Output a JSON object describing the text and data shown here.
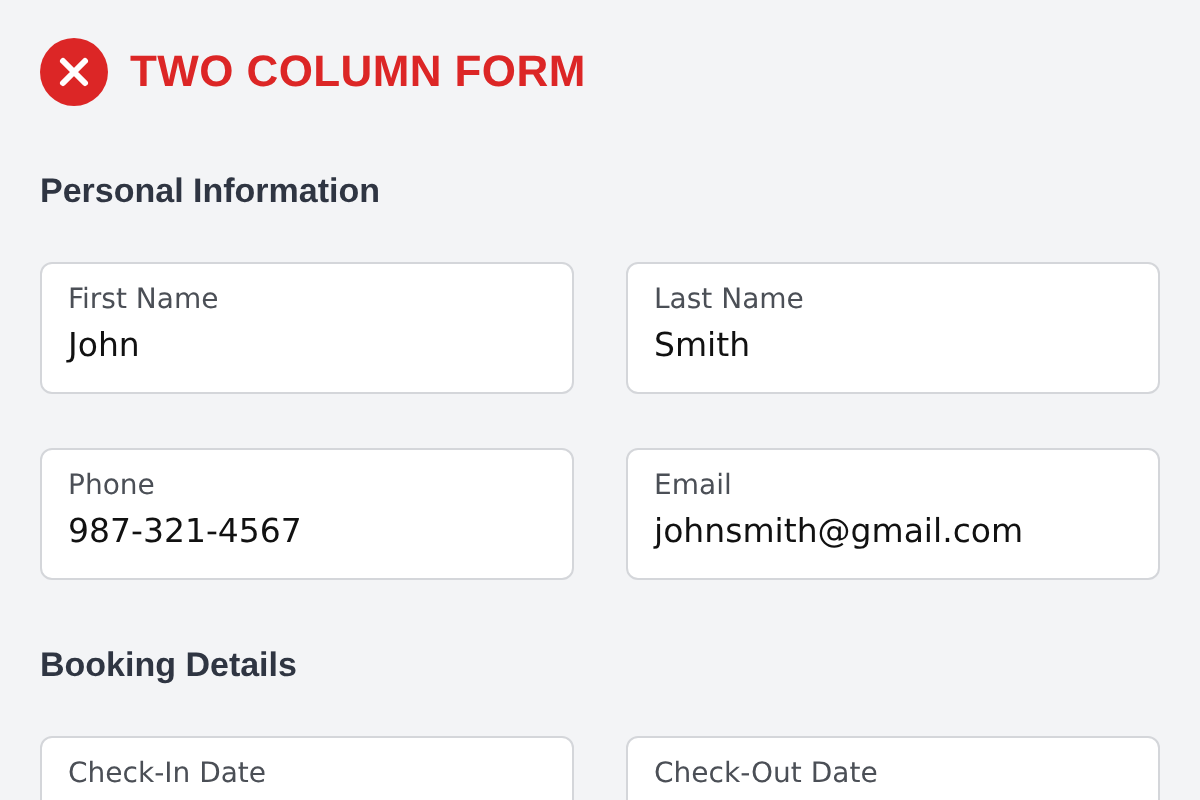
{
  "title": "TWO COLUMN FORM",
  "sections": [
    {
      "heading": "Personal Information",
      "fields": [
        {
          "label": "First Name",
          "value": "John"
        },
        {
          "label": "Last Name",
          "value": "Smith"
        },
        {
          "label": "Phone",
          "value": "987-321-4567"
        },
        {
          "label": "Email",
          "value": "johnsmith@gmail.com"
        }
      ]
    },
    {
      "heading": "Booking Details",
      "fields": [
        {
          "label": "Check-In Date"
        },
        {
          "label": "Check-Out Date"
        }
      ]
    }
  ]
}
